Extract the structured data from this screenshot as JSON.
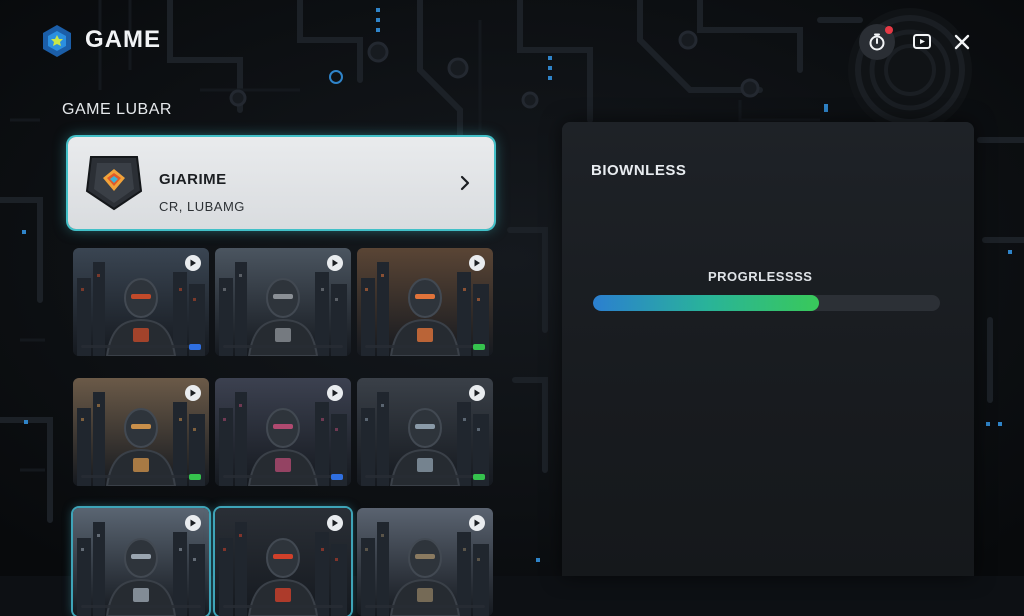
{
  "header": {
    "title": "GAME",
    "icons": {
      "logo": "game-logo-icon",
      "timer": "timer-icon",
      "cast": "cast-icon",
      "close": "close-icon"
    },
    "timer_badge_color": "#e53945"
  },
  "library": {
    "label": "GAME LUBAR",
    "featured": {
      "title": "GIARIME",
      "subtitle": "CR, LUBAMG",
      "icon": "game-emblem-icon"
    },
    "tiles": [
      {
        "name": "armored-knight",
        "chip": "#2f6fe0",
        "selected": false
      },
      {
        "name": "cyber-soldier",
        "chip": "",
        "selected": false
      },
      {
        "name": "young-pilot",
        "chip": "#35c24d",
        "selected": false
      },
      {
        "name": "masked-warrior",
        "chip": "#35c24d",
        "selected": false
      },
      {
        "name": "hooded-heroine",
        "chip": "#2f6fe0",
        "selected": false
      },
      {
        "name": "hooded-operative",
        "chip": "#35c24d",
        "selected": false
      },
      {
        "name": "wide-hat-ranger",
        "chip": "",
        "selected": true
      },
      {
        "name": "red-eye-sentinel",
        "chip": "",
        "selected": true
      },
      {
        "name": "street-agent",
        "chip": "",
        "selected": false
      }
    ]
  },
  "panel": {
    "title": "BIOWNLESS",
    "progress_label": "PROGRLESSSS",
    "progress_value": 0.65
  },
  "colors": {
    "accent": "#42c0c8",
    "background": "#0d1014"
  }
}
